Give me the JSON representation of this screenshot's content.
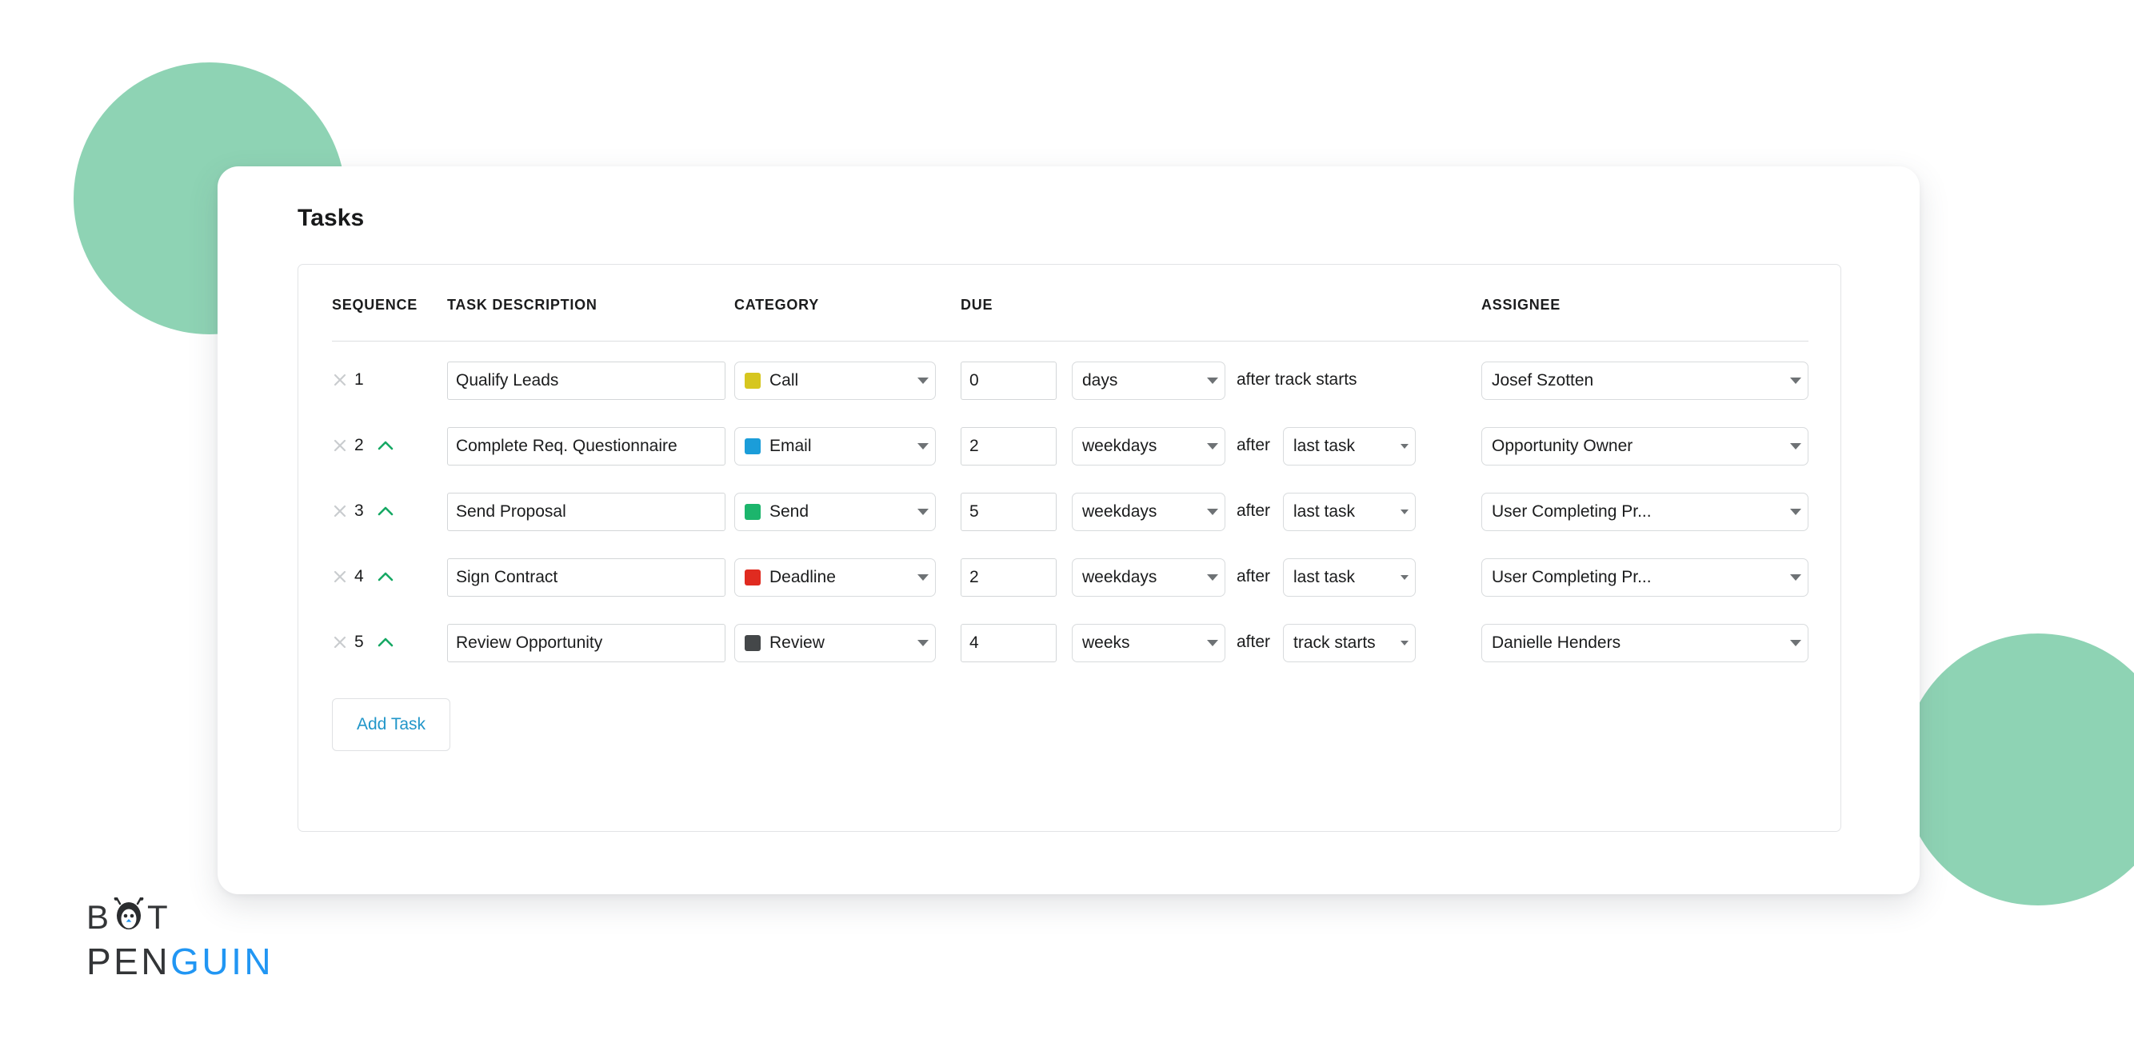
{
  "card": {
    "title": "Tasks",
    "add_task_label": "Add Task"
  },
  "table": {
    "headers": {
      "sequence": "SEQUENCE",
      "task_description": "TASK DESCRIPTION",
      "category": "CATEGORY",
      "due": "DUE",
      "assignee": "ASSIGNEE"
    },
    "rows": [
      {
        "sequence": "1",
        "description": "Qualify Leads",
        "category": "Call",
        "category_color": "#d6c61f",
        "due_number": "0",
        "due_unit": "days",
        "after_label": "after track starts",
        "anchor": "",
        "assignee": "Josef Szotten",
        "has_move_up": false
      },
      {
        "sequence": "2",
        "description": "Complete Req. Questionnaire",
        "category": "Email",
        "category_color": "#1b9dd9",
        "due_number": "2",
        "due_unit": "weekdays",
        "after_label": "after",
        "anchor": "last task",
        "assignee": "Opportunity Owner",
        "has_move_up": true
      },
      {
        "sequence": "3",
        "description": "Send Proposal",
        "category": "Send",
        "category_color": "#1cb56c",
        "due_number": "5",
        "due_unit": "weekdays",
        "after_label": "after",
        "anchor": "last task",
        "assignee": "User Completing Pr...",
        "has_move_up": true
      },
      {
        "sequence": "4",
        "description": "Sign Contract",
        "category": "Deadline",
        "category_color": "#e02b20",
        "due_number": "2",
        "due_unit": "weekdays",
        "after_label": "after",
        "anchor": "last task",
        "assignee": "User Completing Pr...",
        "has_move_up": true
      },
      {
        "sequence": "5",
        "description": "Review Opportunity",
        "category": "Review",
        "category_color": "#444749",
        "due_number": "4",
        "due_unit": "weeks",
        "after_label": "after",
        "anchor": "track starts",
        "assignee": "Danielle Henders",
        "has_move_up": true
      }
    ]
  },
  "logo": {
    "line1_before": "B",
    "line1_after": "T",
    "line2_dark": "PEN",
    "line2_blue": "GUIN",
    "blue": "#2196f3",
    "dark": "#333537"
  },
  "theme": {
    "accent_blue": "#2196c9",
    "decor_green": "#8ed3b4",
    "move_up_green": "#16a864",
    "remove_gray": "#c9cccf"
  }
}
